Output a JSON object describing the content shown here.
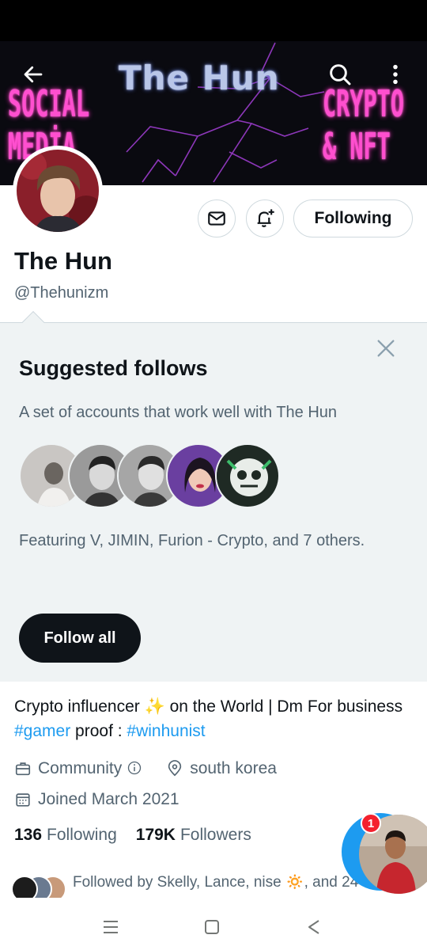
{
  "banner": {
    "title": "The Hun",
    "left_neon": [
      "SOCIAL",
      "MEDİA"
    ],
    "right_neon": [
      "CRYPTO",
      "& NFT"
    ]
  },
  "profile": {
    "name": "The Hun",
    "handle": "@Thehunizm",
    "following_button": "Following"
  },
  "suggested": {
    "title": "Suggested follows",
    "description": "A set of accounts that work well with The Hun",
    "featuring": "Featuring V, JIMIN, Furion - Crypto, and 7 others.",
    "follow_all": "Follow all"
  },
  "bio": {
    "text_1": "Crypto influencer ",
    "emoji": "✨",
    "text_2": " on the World | Dm For business ",
    "tag_1": "#gamer",
    "text_3": " proof : ",
    "tag_2": "#winhunist"
  },
  "meta": {
    "category": "Community",
    "location": "south korea",
    "joined": "Joined March 2021"
  },
  "counts": {
    "following_number": "136",
    "following_label": "Following",
    "followers_number": "179K",
    "followers_label": "Followers"
  },
  "followed_by": {
    "text": "Followed by Skelly, Lance, nise 🔅, and 24"
  },
  "fab": {
    "badge": "1"
  },
  "colors": {
    "accent": "#1d9bf0",
    "text_primary": "#0f1419",
    "text_secondary": "#536471",
    "suggest_bg": "#eff3f4",
    "neon_pink": "#ff4fcf",
    "badge_red": "#f4212e"
  }
}
